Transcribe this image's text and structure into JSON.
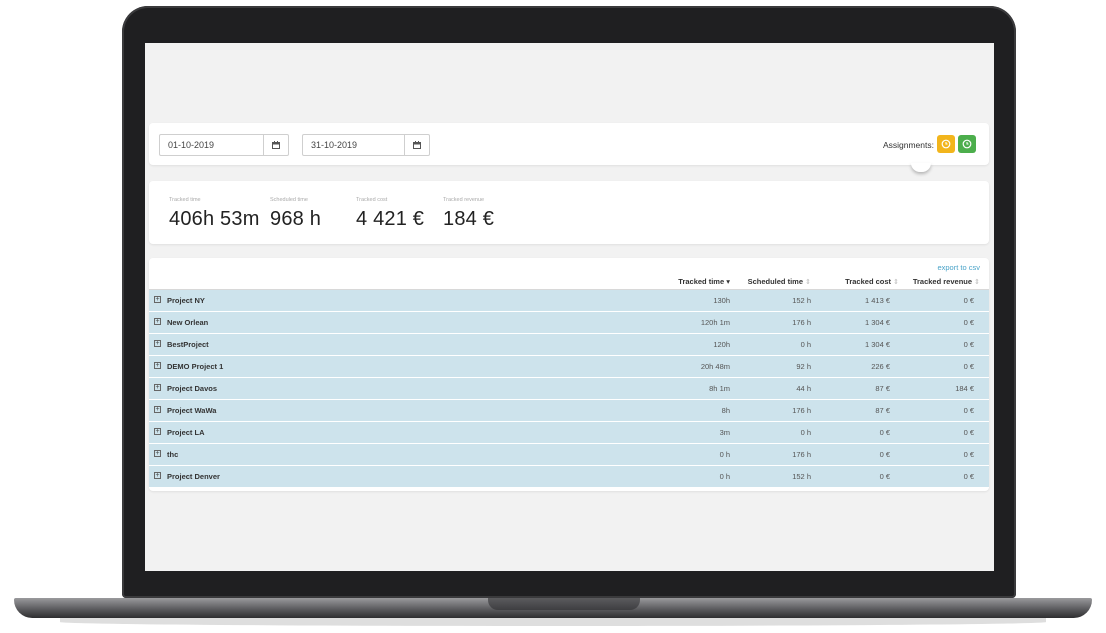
{
  "filters": {
    "start_date": "01-10-2019",
    "end_date": "31-10-2019",
    "assignments_label": "Assignments:"
  },
  "stats": [
    {
      "label": "Tracked time",
      "value": "406h 53m"
    },
    {
      "label": "Scheduled time",
      "value": "968 h"
    },
    {
      "label": "Tracked cost",
      "value": "4 421 €"
    },
    {
      "label": "Tracked revenue",
      "value": "184 €"
    }
  ],
  "table": {
    "export_label": "export to csv",
    "headers": {
      "tracked_time": "Tracked time",
      "scheduled_time": "Scheduled time",
      "tracked_cost": "Tracked cost",
      "tracked_revenue": "Tracked revenue"
    },
    "rows": [
      {
        "name": "Project NY",
        "tracked_time": "130h",
        "scheduled_time": "152 h",
        "tracked_cost": "1 413 €",
        "tracked_revenue": "0 €"
      },
      {
        "name": "New Orlean",
        "tracked_time": "120h 1m",
        "scheduled_time": "176 h",
        "tracked_cost": "1 304 €",
        "tracked_revenue": "0 €"
      },
      {
        "name": "BestProject",
        "tracked_time": "120h",
        "scheduled_time": "0 h",
        "tracked_cost": "1 304 €",
        "tracked_revenue": "0 €"
      },
      {
        "name": "DEMO Project 1",
        "tracked_time": "20h 48m",
        "scheduled_time": "92 h",
        "tracked_cost": "226 €",
        "tracked_revenue": "0 €"
      },
      {
        "name": "Project Davos",
        "tracked_time": "8h 1m",
        "scheduled_time": "44 h",
        "tracked_cost": "87 €",
        "tracked_revenue": "184 €"
      },
      {
        "name": "Project WaWa",
        "tracked_time": "8h",
        "scheduled_time": "176 h",
        "tracked_cost": "87 €",
        "tracked_revenue": "0 €"
      },
      {
        "name": "Project LA",
        "tracked_time": "3m",
        "scheduled_time": "0 h",
        "tracked_cost": "0 €",
        "tracked_revenue": "0 €"
      },
      {
        "name": "thc",
        "tracked_time": "0 h",
        "scheduled_time": "176 h",
        "tracked_cost": "0 €",
        "tracked_revenue": "0 €"
      },
      {
        "name": "Project Denver",
        "tracked_time": "0 h",
        "scheduled_time": "152 h",
        "tracked_cost": "0 €",
        "tracked_revenue": "0 €"
      }
    ]
  },
  "colors": {
    "row_bg": "#cde3ec",
    "assign_yellow": "#f2b51c",
    "assign_green": "#4cae4c",
    "link": "#4aa3c8"
  },
  "icons": {
    "calendar": "calendar-icon",
    "expand": "expand-plus-icon",
    "assign_yellow": "clock-icon",
    "assign_green": "clock-icon"
  }
}
